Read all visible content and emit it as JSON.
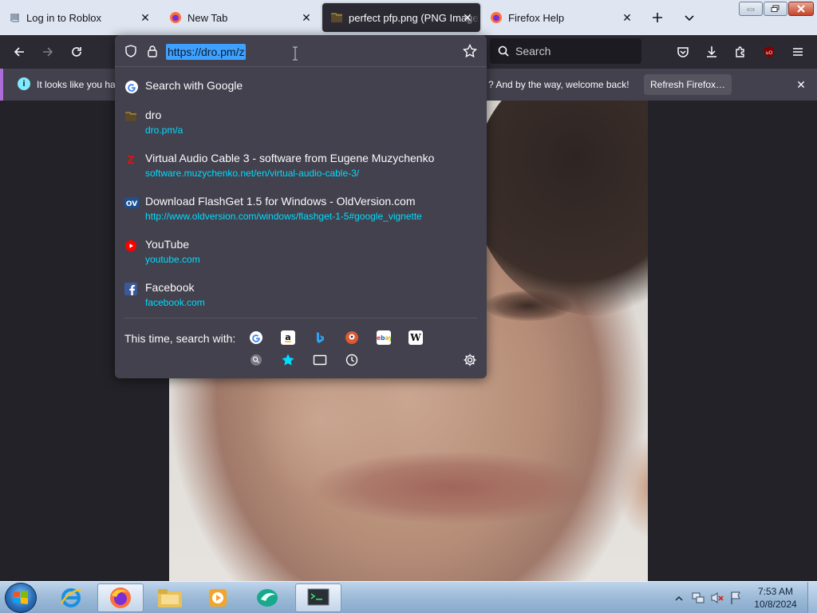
{
  "tabs": [
    {
      "label": "Log in to Roblox",
      "icon": "roblox-page-icon",
      "active": false
    },
    {
      "label": "New Tab",
      "icon": "firefox-icon",
      "active": false
    },
    {
      "label": "perfect pfp.png (PNG Image",
      "icon": "image-icon",
      "active": true
    },
    {
      "label": "Firefox Help",
      "icon": "firefox-icon",
      "active": false
    }
  ],
  "navbar": {
    "search_placeholder": "Search"
  },
  "notification": {
    "text_left": "It looks like you ha",
    "text_right": "? And by the way, welcome back!",
    "button_label": "Refresh Firefox…"
  },
  "urlbar": {
    "value": "https://dro.pm/z",
    "search_with": "Search with Google",
    "suggestions": [
      {
        "title": "dro",
        "url": "dro.pm/a",
        "icon": "image-icon"
      },
      {
        "title": "Virtual Audio Cable 3 - software from Eugene Muzychenko",
        "url": "software.muzychenko.net/en/virtual-audio-cable-3/",
        "icon": "muzychenko-icon"
      },
      {
        "title": "Download FlashGet 1.5 for Windows - OldVersion.com",
        "url": "http://www.oldversion.com/windows/flashget-1-5#google_vignette",
        "icon": "oldversion-icon"
      },
      {
        "title": "YouTube",
        "url": "youtube.com",
        "icon": "youtube-icon"
      },
      {
        "title": "Facebook",
        "url": "facebook.com",
        "icon": "facebook-icon"
      }
    ],
    "one_off_label": "This time, search with:",
    "engines": [
      "google",
      "amazon",
      "bing",
      "duckduckgo",
      "ebay",
      "wikipedia"
    ],
    "modes": [
      "search-history",
      "bookmarks",
      "tabs",
      "history"
    ]
  },
  "taskbar": {
    "apps": [
      "internet-explorer",
      "firefox",
      "file-explorer",
      "media-player",
      "app-teal",
      "terminal-app"
    ],
    "time": "7:53 AM",
    "date": "10/8/2024"
  },
  "colors": {
    "accent": "#00ddff",
    "panel": "#42414d",
    "toolbar": "#2b2a33",
    "notif_border": "#ad6cd8"
  }
}
